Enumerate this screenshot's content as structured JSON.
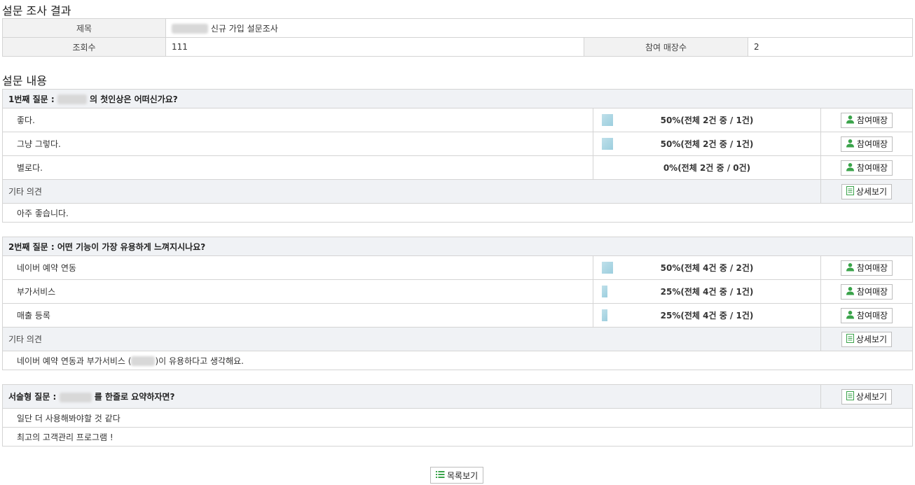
{
  "page": {
    "result_title": "설문 조사 결과",
    "content_title": "설문 내용"
  },
  "info": {
    "title_label": "제목",
    "title_value": "신규 가입 설문조사",
    "views_label": "조회수",
    "views_value": "111",
    "stores_label": "참여 매장수",
    "stores_value": "2"
  },
  "buttons": {
    "participants": "참여매장",
    "detail": "상세보기",
    "list": "목록보기"
  },
  "etc_label": "기타 의견",
  "questions": [
    {
      "header_prefix": "1번째 질문 :",
      "header_suffix": "의 첫인상은 어떠신가요?",
      "options": [
        {
          "label": "좋다.",
          "stat": "50%(전체 2건 중 / 1건)",
          "ratio": 0.5
        },
        {
          "label": "그냥 그렇다.",
          "stat": "50%(전체 2건 중 / 1건)",
          "ratio": 0.5
        },
        {
          "label": "별로다.",
          "stat": "0%(전체 2건 중 / 0건)",
          "ratio": 0
        }
      ],
      "etc_text": "아주 좋습니다."
    },
    {
      "header_prefix": "2번째 질문 : 어떤 기능이 가장 유용하게 느껴지시나요?",
      "options": [
        {
          "label": "네이버 예약 연동",
          "stat": "50%(전체 4건 중 / 2건)",
          "ratio": 0.5
        },
        {
          "label": "부가서비스",
          "stat": "25%(전체 4건 중 / 1건)",
          "ratio": 0.25
        },
        {
          "label": "매출 등록",
          "stat": "25%(전체 4건 중 / 1건)",
          "ratio": 0.25
        }
      ],
      "etc_text_prefix": "네이버 예약 연동과 부가서비스 (",
      "etc_text_suffix": ")이 유용하다고 생각해요."
    }
  ],
  "descriptive": {
    "header_prefix": "서술형 질문 :",
    "header_suffix": "를 한줄로 요약하자면?",
    "answers": [
      "일단 더 사용해봐야할 것 같다",
      "최고의 고객관리 프로그램 !"
    ]
  },
  "colors": {
    "bar": "#9ccede",
    "header_bg": "#f0f2f5",
    "icon_green": "#3aa34a"
  }
}
